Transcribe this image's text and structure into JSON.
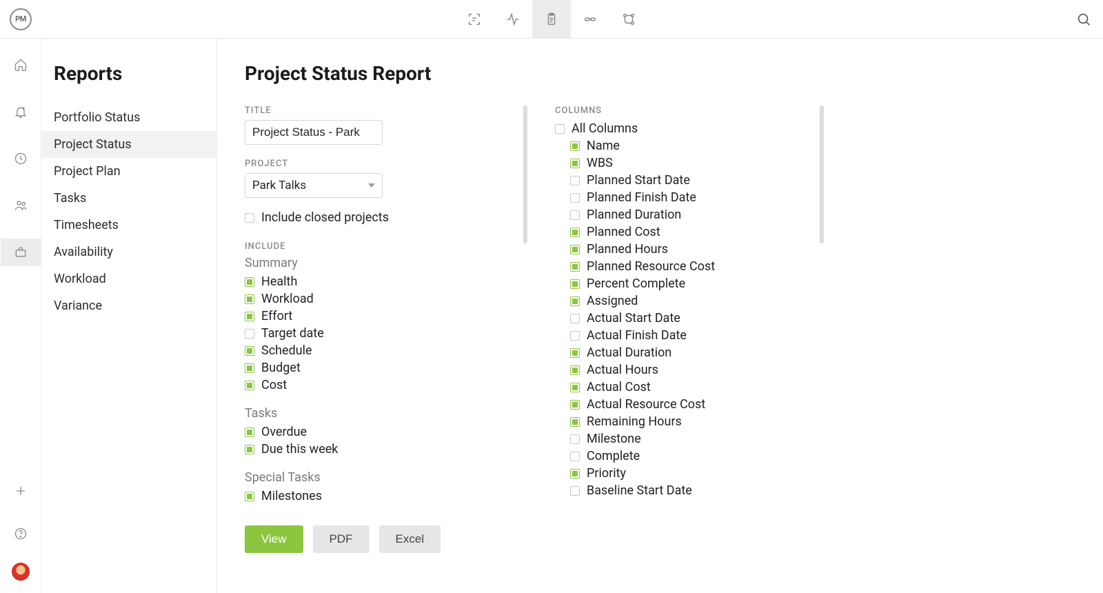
{
  "sidebar": {
    "title": "Reports",
    "items": [
      {
        "label": "Portfolio Status",
        "active": false
      },
      {
        "label": "Project Status",
        "active": true
      },
      {
        "label": "Project Plan",
        "active": false
      },
      {
        "label": "Tasks",
        "active": false
      },
      {
        "label": "Timesheets",
        "active": false
      },
      {
        "label": "Availability",
        "active": false
      },
      {
        "label": "Workload",
        "active": false
      },
      {
        "label": "Variance",
        "active": false
      }
    ]
  },
  "main": {
    "heading": "Project Status Report",
    "title_label": "TITLE",
    "title_value": "Project Status - Park",
    "project_label": "PROJECT",
    "project_value": "Park Talks",
    "include_closed_label": "Include closed projects",
    "include_label": "INCLUDE",
    "group_summary": "Summary",
    "summary_items": [
      {
        "label": "Health",
        "checked": true
      },
      {
        "label": "Workload",
        "checked": true
      },
      {
        "label": "Effort",
        "checked": true
      },
      {
        "label": "Target date",
        "checked": false
      },
      {
        "label": "Schedule",
        "checked": true
      },
      {
        "label": "Budget",
        "checked": true
      },
      {
        "label": "Cost",
        "checked": true
      }
    ],
    "group_tasks": "Tasks",
    "tasks_items": [
      {
        "label": "Overdue",
        "checked": true
      },
      {
        "label": "Due this week",
        "checked": true
      }
    ],
    "group_special": "Special Tasks",
    "special_items": [
      {
        "label": "Milestones",
        "checked": true
      }
    ],
    "columns_label": "COLUMNS",
    "all_columns_label": "All Columns",
    "columns": [
      {
        "label": "Name",
        "checked": true
      },
      {
        "label": "WBS",
        "checked": true
      },
      {
        "label": "Planned Start Date",
        "checked": false
      },
      {
        "label": "Planned Finish Date",
        "checked": false
      },
      {
        "label": "Planned Duration",
        "checked": false
      },
      {
        "label": "Planned Cost",
        "checked": true
      },
      {
        "label": "Planned Hours",
        "checked": true
      },
      {
        "label": "Planned Resource Cost",
        "checked": true
      },
      {
        "label": "Percent Complete",
        "checked": true
      },
      {
        "label": "Assigned",
        "checked": true
      },
      {
        "label": "Actual Start Date",
        "checked": false
      },
      {
        "label": "Actual Finish Date",
        "checked": false
      },
      {
        "label": "Actual Duration",
        "checked": true
      },
      {
        "label": "Actual Hours",
        "checked": true
      },
      {
        "label": "Actual Cost",
        "checked": true
      },
      {
        "label": "Actual Resource Cost",
        "checked": true
      },
      {
        "label": "Remaining Hours",
        "checked": true
      },
      {
        "label": "Milestone",
        "checked": false
      },
      {
        "label": "Complete",
        "checked": false
      },
      {
        "label": "Priority",
        "checked": true
      },
      {
        "label": "Baseline Start Date",
        "checked": false
      }
    ],
    "btn_view": "View",
    "btn_pdf": "PDF",
    "btn_excel": "Excel"
  }
}
